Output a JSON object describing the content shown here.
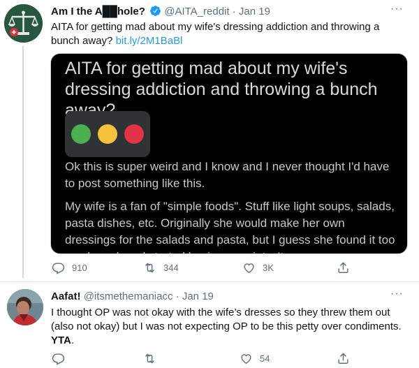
{
  "tweets": [
    {
      "name": "Am I the A██hole?",
      "handle": "@AITA_reddit",
      "dot": "·",
      "date": "Jan 19",
      "text": "AITA for getting mad about my wife's dressing addiction and throwing a bunch away? ",
      "link": "bit.ly/2M1BaBl",
      "card": {
        "title": "AITA for getting mad about my wife's dressing addiction and throwing a bunch away?",
        "paragraph1": "Ok this is super weird and I know and I never thought I'd have to post something like this.",
        "paragraph2": "My wife is a fan of \"simple foods\". Stuff like light soups, salads, pasta dishes, etc. Originally she would make her own dressings for the salads and pasta, but I guess she found it too much work and started buying a variety. It"
      },
      "replies": "910",
      "retweets": "344",
      "likes": "3K"
    },
    {
      "name": "Aafat!",
      "handle": "@itsmethemaniacc",
      "dot": "·",
      "date": "Jan 19",
      "text": "I thought OP was not okay with the wife’s dresses so they threw them out (also not okay) but I was not expecting OP to be this petty over condiments. ",
      "text_bold": "YTA",
      "text_end": ".",
      "replies": "",
      "retweets": "",
      "likes": "54"
    }
  ],
  "icons": {
    "more": "more-horizontal-icon",
    "reply": "reply-icon",
    "retweet": "retweet-icon",
    "like": "heart-icon",
    "share": "share-icon",
    "verified": "verified-badge-icon"
  },
  "colors": {
    "link": "#1d9bf0",
    "verified": "#1d9bf0",
    "secondary_text": "#5b7083",
    "card_bg": "#000000",
    "light_green": "#4caf50",
    "light_yellow": "#f5c33b",
    "light_red": "#e03445"
  },
  "more_label": "···"
}
